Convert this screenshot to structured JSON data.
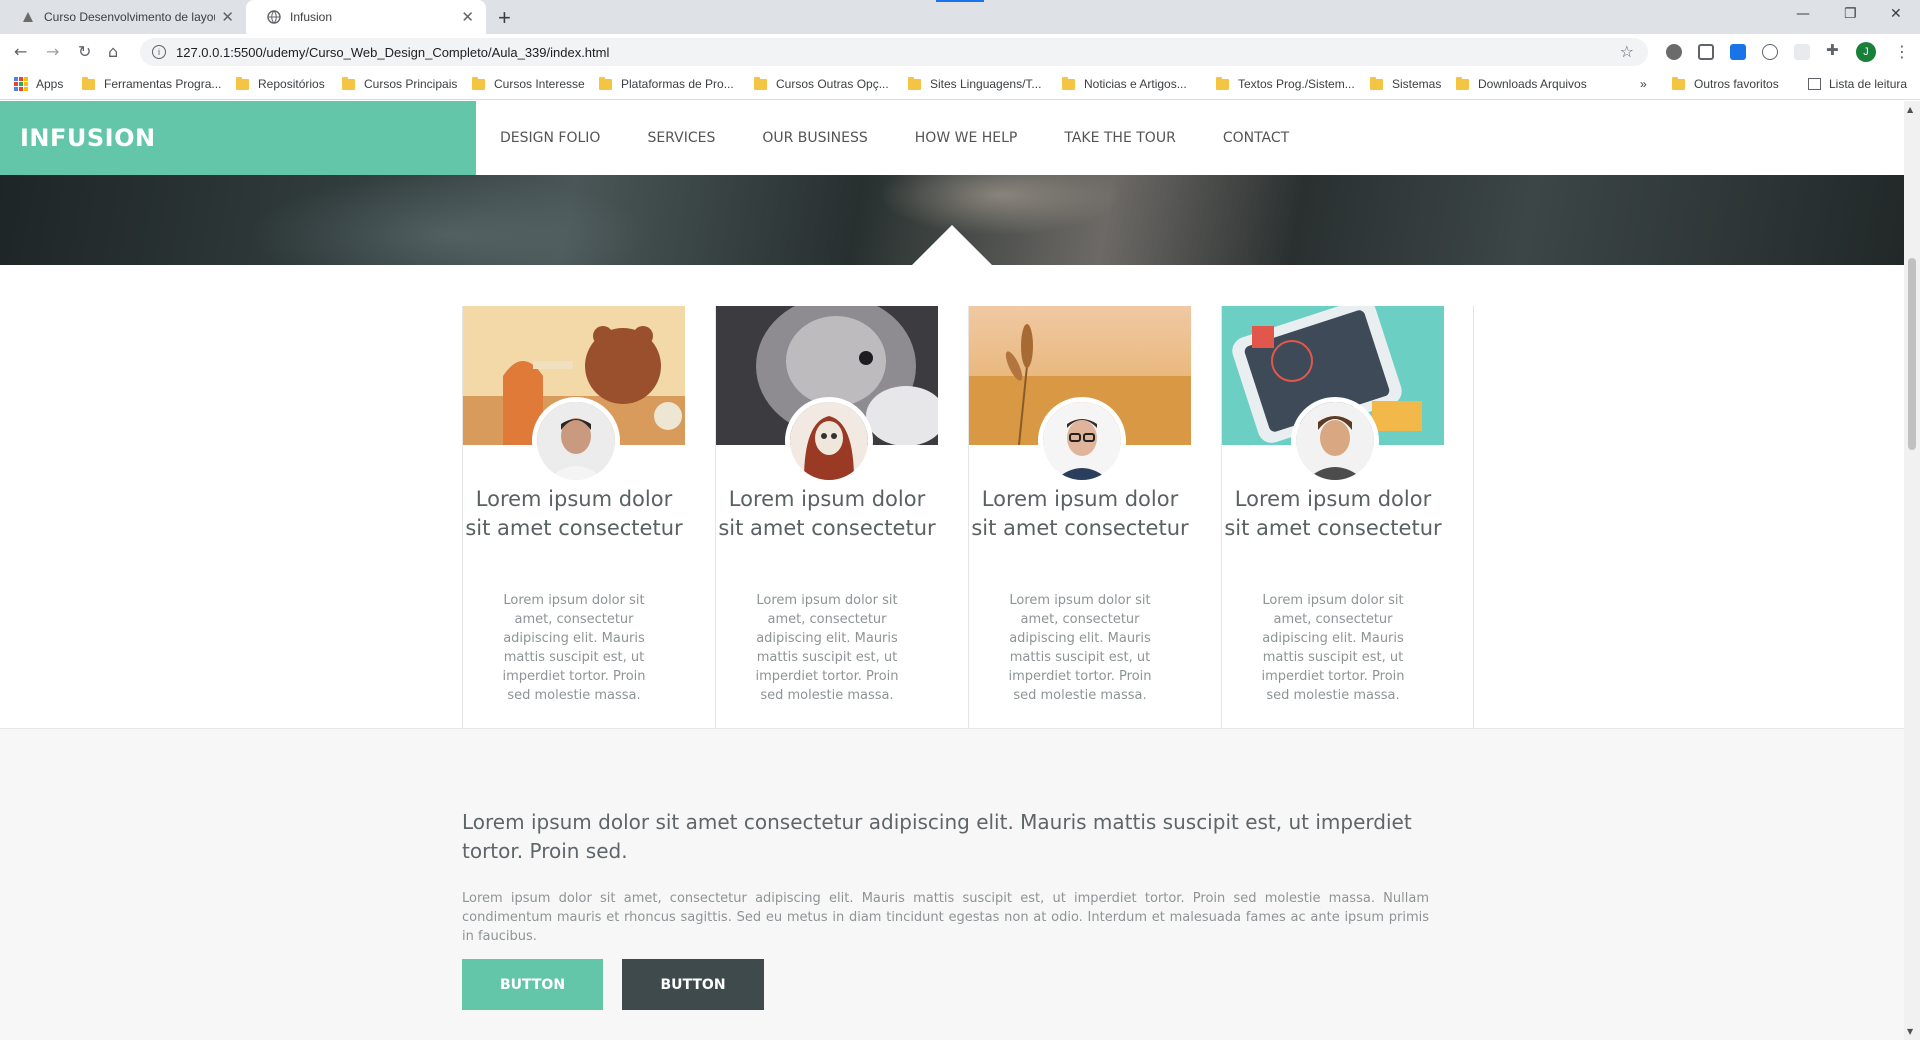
{
  "browser": {
    "tabs": [
      {
        "title": "Curso Desenvolvimento de layou",
        "active": false
      },
      {
        "title": "Infusion",
        "active": true
      }
    ],
    "url": "127.0.0.1:5500/udemy/Curso_Web_Design_Completo/Aula_339/index.html",
    "profile_initial": "J",
    "bookmarks": [
      "Apps",
      "Ferramentas Progra...",
      "Repositórios",
      "Cursos Principais",
      "Cursos Interesse",
      "Plataformas de Pro...",
      "Cursos Outras Opç...",
      "Sites Linguagens/T...",
      "Noticias e Artigos...",
      "Textos Prog./Sistem...",
      "Sistemas",
      "Downloads Arquivos"
    ],
    "bookmarks_overflow": "»",
    "other_bookmarks": "Outros favoritos",
    "reading_list": "Lista de leitura"
  },
  "site": {
    "logo": "INFUSION",
    "menu": [
      "DESIGN FOLIO",
      "SERVICES",
      "OUR BUSINESS",
      "HOW WE HELP",
      "TAKE THE TOUR",
      "CONTACT"
    ],
    "team": [
      {
        "name": "Lorem ipsum dolor sit amet consectetur",
        "desc": "Lorem ipsum dolor sit amet, consectetur adipiscing elit. Mauris mattis suscipit est, ut imperdiet tortor. Proin sed molestie massa."
      },
      {
        "name": "Lorem ipsum dolor sit amet consectetur",
        "desc": "Lorem ipsum dolor sit amet, consectetur adipiscing elit. Mauris mattis suscipit est, ut imperdiet tortor. Proin sed molestie massa."
      },
      {
        "name": "Lorem ipsum dolor sit amet consectetur",
        "desc": "Lorem ipsum dolor sit amet, consectetur adipiscing elit. Mauris mattis suscipit est, ut imperdiet tortor. Proin sed molestie massa."
      },
      {
        "name": "Lorem ipsum dolor sit amet consectetur",
        "desc": "Lorem ipsum dolor sit amet, consectetur adipiscing elit. Mauris mattis suscipit est, ut imperdiet tortor. Proin sed molestie massa."
      }
    ],
    "lead": "Lorem ipsum dolor sit amet consectetur adipiscing elit. Mauris mattis suscipit est, ut imperdiet tortor. Proin sed.",
    "body": "Lorem ipsum dolor sit amet, consectetur adipiscing elit. Mauris mattis suscipit est, ut imperdiet tortor. Proin sed molestie massa. Nullam condimentum mauris et rhoncus sagittis. Sed eu metus in diam tincidunt egestas non at odio. Interdum et malesuada fames ac ante ipsum primis in faucibus.",
    "buttons": [
      "BUTTON",
      "BUTTON"
    ]
  },
  "colors": {
    "accent": "#64c6a9",
    "dark": "#3f4a4d"
  }
}
